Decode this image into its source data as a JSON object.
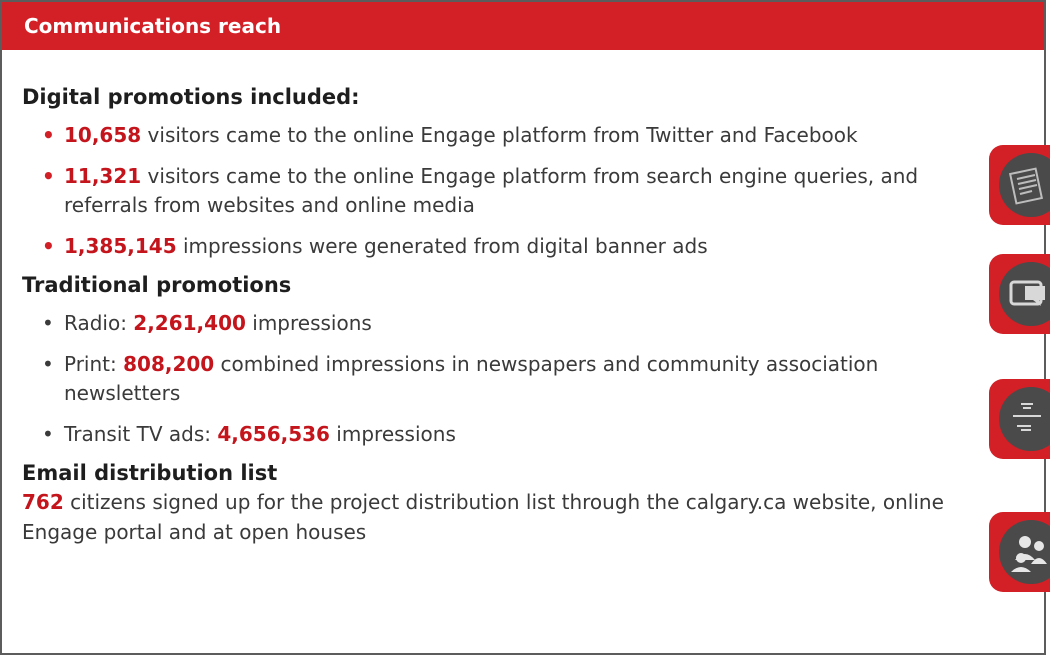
{
  "header": {
    "title": "Communications reach"
  },
  "digital": {
    "heading": "Digital promotions included:",
    "items": [
      {
        "num": "10,658",
        "text": " visitors came to the online Engage platform from Twitter and Facebook"
      },
      {
        "num": "11,321",
        "text": " visitors came to the online Engage platform from search engine queries, and referrals from websites and online media"
      },
      {
        "num": "1,385,145",
        "text": " impressions were generated from digital banner ads"
      }
    ]
  },
  "traditional": {
    "heading": "Traditional promotions",
    "items": [
      {
        "prefix": "Radio: ",
        "num": "2,261,400",
        "text": " impressions"
      },
      {
        "prefix": "Print: ",
        "num": "808,200",
        "text": " combined impressions in newspapers and community association newsletters"
      },
      {
        "prefix": "Transit TV ads: ",
        "num": "4,656,536",
        "text": " impressions"
      }
    ]
  },
  "email": {
    "heading": "Email distribution list",
    "num": "762",
    "text": " citizens signed up for the project distribution list through the calgary.ca website, online Engage portal and at open houses"
  },
  "side_icons": [
    "newspaper-icon",
    "chat-bubble-icon",
    "multilingual-ad-icon",
    "people-icon"
  ],
  "colors": {
    "accent": "#d31f26",
    "number": "#c4141c",
    "icon_circle": "#4a4a4a"
  }
}
